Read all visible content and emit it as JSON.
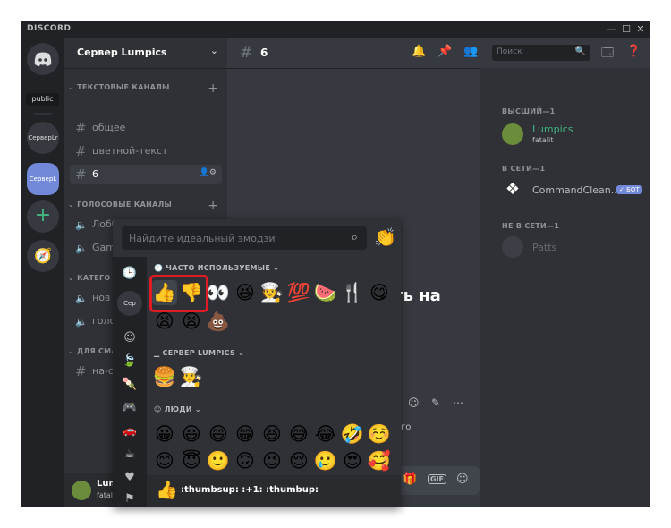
{
  "window": {
    "brand": "DISCORD",
    "minimize": "—",
    "maximize": "☐",
    "close": "✕"
  },
  "rail": {
    "tooltip": "public",
    "servers": [
      "СерверLr",
      "СерверL"
    ]
  },
  "sidebar": {
    "server_name": "Сервер Lumpics",
    "cat_text": "ТЕКСТОВЫЕ КАНАЛЫ",
    "text_channels": [
      {
        "name": "общее"
      },
      {
        "name": "цветной-текст"
      },
      {
        "name": "6"
      }
    ],
    "cat_voice": "ГОЛОСОВЫЕ КАНАЛЫ",
    "voice_channels": [
      {
        "name": "Лобби"
      },
      {
        "name": "Gam"
      }
    ],
    "cat_other": "КАТЕГО",
    "other_channels": [
      {
        "name": "нов"
      },
      {
        "name": "голо"
      }
    ],
    "cat_dlya": "ДЛЯ СМА",
    "extra_channels": [
      {
        "name": "на-с"
      }
    ],
    "user": {
      "name": "Lum",
      "tag": "fatal"
    }
  },
  "topbar": {
    "channel": "6",
    "search_placeholder": "Поиск"
  },
  "main": {
    "welcome_partial": "ать на",
    "go_partial": "го"
  },
  "members": {
    "groups": [
      {
        "title": "ВЫСШИЙ—1",
        "members": [
          {
            "name": "Lumpics",
            "sub": "fatalit"
          }
        ]
      },
      {
        "title": "В СЕТИ—1",
        "members": [
          {
            "name": "CommandClean...",
            "badge": "✓ БОТ"
          }
        ]
      },
      {
        "title": "НЕ В СЕТИ—1",
        "members": [
          {
            "name": "Patts"
          }
        ]
      }
    ]
  },
  "picker": {
    "search_placeholder": "Найдите идеальный эмодзи",
    "server_short": "Сер",
    "sections": {
      "frequent": "ЧАСТО ИСПОЛЬЗУЕМЫЕ",
      "server": "СЕРВЕР LUMPICS",
      "people": "ЛЮДИ"
    },
    "frequent_emojis": [
      "👍",
      "👎",
      "👀",
      "😆",
      "🧑‍🍳",
      "💯",
      "🍉",
      "🍴",
      "😋",
      "😫",
      "😫",
      "💩"
    ],
    "server_emojis": [
      "🍔",
      "🧑‍🍳"
    ],
    "people_emojis": [
      "😀",
      "😃",
      "😄",
      "😁",
      "😆",
      "😅",
      "😂",
      "🤣",
      "☺️",
      "😊",
      "😇",
      "🙂",
      "🙃",
      "😉",
      "😌",
      "🥲",
      "😍",
      "🥰"
    ],
    "footer": {
      "emoji": "👍",
      "text": ":thumbsup: :+1: :thumbup:"
    }
  }
}
